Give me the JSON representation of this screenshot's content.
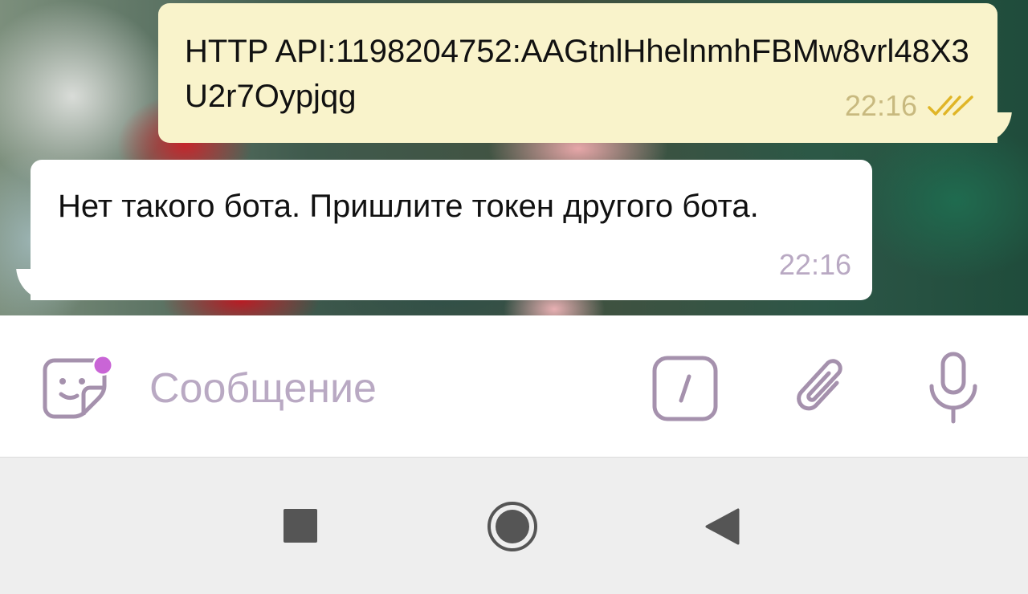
{
  "messages": [
    {
      "direction": "outgoing",
      "text": "HTTP API:1198204752:AAGtnlHhelnmhFBMw8vrl48X3U2r7Oypjqg",
      "time": "22:16",
      "status": "read"
    },
    {
      "direction": "incoming",
      "text": "Нет такого бота. Пришлите токен другого бота.",
      "time": "22:16"
    }
  ],
  "composer": {
    "placeholder": "Сообщение",
    "value": "",
    "sticker_icon": "sticker-smile-icon",
    "sticker_badge_color": "#c965d6",
    "command_icon": "slash-command-icon",
    "attach_icon": "paperclip-icon",
    "mic_icon": "microphone-icon"
  },
  "navigation": {
    "recents_icon": "square-recents-icon",
    "home_icon": "circle-home-icon",
    "back_icon": "triangle-back-icon"
  },
  "colors": {
    "outgoing_bubble": "#f9f3cb",
    "incoming_bubble": "#ffffff",
    "outgoing_meta": "#c8b97f",
    "read_checks": "#e0b526",
    "incoming_meta": "#b9a9c3",
    "composer_icons": "#a591ad",
    "nav_icons": "#555555"
  }
}
